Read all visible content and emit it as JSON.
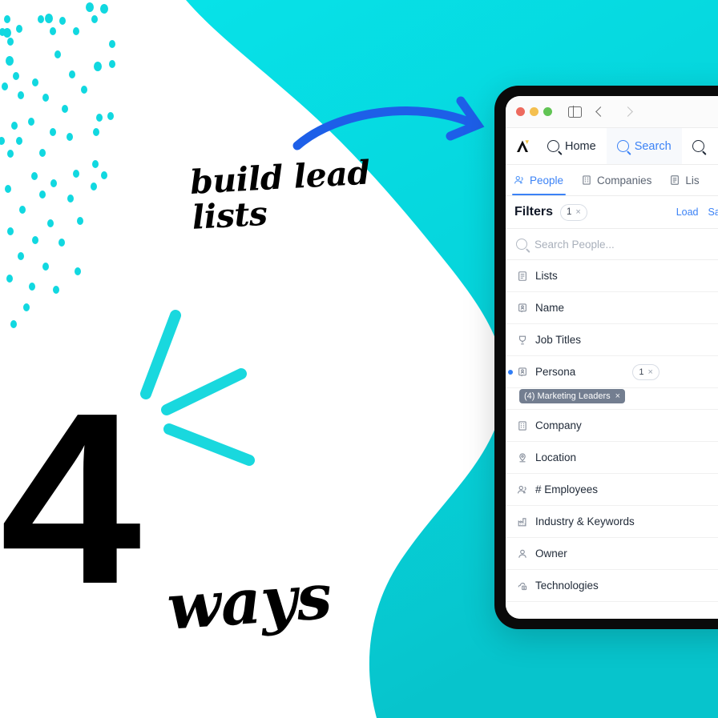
{
  "poster": {
    "headline_number": "4",
    "headline_word": "ways",
    "annotation_line1": "build lead",
    "annotation_line2": "lists",
    "colors": {
      "teal": "#06dce4",
      "teal_deep": "#08c8cf",
      "arrow_blue": "#1d5fe8",
      "ink": "#000000",
      "accent_blue": "#3b82f6"
    },
    "decor": {
      "dot_pattern": "scattered-dots",
      "burst": "sparkle-lines",
      "arrow": "curved-arrow-right"
    }
  },
  "browser": {
    "window_controls": [
      "close",
      "minimize",
      "zoom"
    ],
    "sidebar_toggle_icon": "sidebar-toggle-icon",
    "back_icon": "chevron-left-icon",
    "forward_icon": "chevron-right-icon"
  },
  "app": {
    "logo_label": "Apollo",
    "nav": [
      {
        "label": "Home",
        "icon": "search-icon",
        "active": false
      },
      {
        "label": "Search",
        "icon": "search-icon",
        "active": true
      },
      {
        "label": "",
        "icon": "search-icon",
        "active": false
      }
    ],
    "tabs": [
      {
        "label": "People",
        "icon": "people-icon",
        "active": true
      },
      {
        "label": "Companies",
        "icon": "building-icon",
        "active": false
      },
      {
        "label": "Lis",
        "icon": "list-icon",
        "active": false
      }
    ],
    "filters": {
      "title": "Filters",
      "count": "1",
      "count_clear": "×",
      "load_label": "Load",
      "save_label": "Save",
      "search_placeholder": "Search People...",
      "rows": [
        {
          "label": "Lists",
          "icon": "list-icon",
          "active": false,
          "count": null
        },
        {
          "label": "Name",
          "icon": "id-badge-icon",
          "active": false,
          "count": null
        },
        {
          "label": "Job Titles",
          "icon": "award-icon",
          "active": false,
          "count": null
        },
        {
          "label": "Persona",
          "icon": "id-badge-icon",
          "active": true,
          "count": "1"
        },
        {
          "label": "Company",
          "icon": "building-icon",
          "active": false,
          "count": null
        },
        {
          "label": "Location",
          "icon": "pin-icon",
          "active": false,
          "count": null
        },
        {
          "label": "# Employees",
          "icon": "people-icon",
          "active": false,
          "count": null
        },
        {
          "label": "Industry & Keywords",
          "icon": "factory-icon",
          "active": false,
          "count": null
        },
        {
          "label": "Owner",
          "icon": "person-icon",
          "active": false,
          "count": null
        },
        {
          "label": "Technologies",
          "icon": "tech-icon",
          "active": false,
          "count": null
        }
      ],
      "persona_tag": "(4) Marketing Leaders",
      "persona_tag_remove": "×"
    }
  }
}
